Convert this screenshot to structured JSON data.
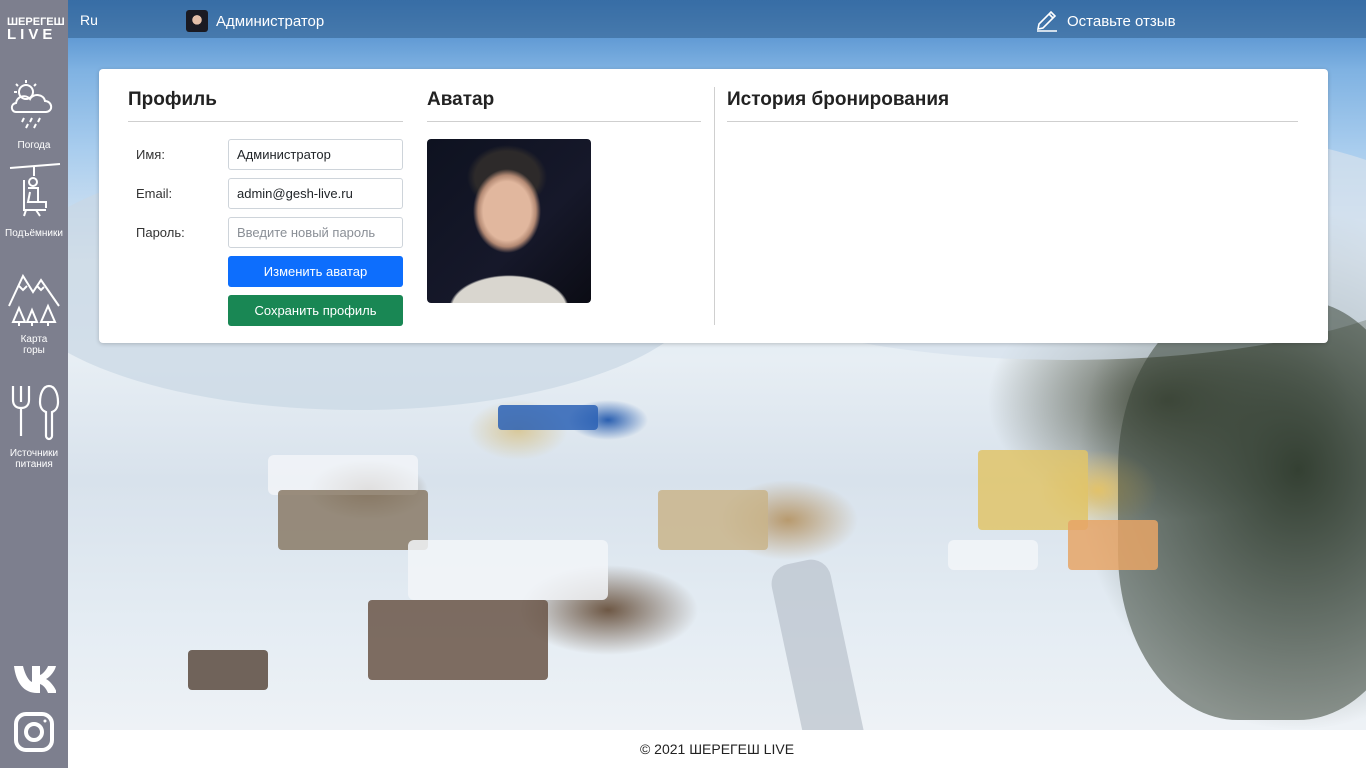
{
  "logo": {
    "line1": "ШЕРЕГЕШ",
    "line2": "LIVE"
  },
  "sidebar": {
    "items": [
      {
        "label": "Погода",
        "icon": "weather-icon"
      },
      {
        "label": "Подъёмники",
        "icon": "ski-lift-icon"
      },
      {
        "label": "Карта горы",
        "icon": "mountain-map-icon"
      },
      {
        "label": "Источники питания",
        "icon": "food-icon"
      }
    ],
    "social": [
      {
        "icon": "vk-icon"
      },
      {
        "icon": "instagram-icon"
      }
    ]
  },
  "topbar": {
    "language": "Ru",
    "username": "Администратор",
    "feedback_label": "Оставьте отзыв"
  },
  "profile": {
    "title": "Профиль",
    "name_label": "Имя:",
    "name_value": "Администратор",
    "email_label": "Email:",
    "email_value": "admin@gesh-live.ru",
    "password_label": "Пароль:",
    "password_placeholder": "Введите новый пароль",
    "change_avatar_label": "Изменить аватар",
    "save_profile_label": "Сохранить профиль"
  },
  "avatar": {
    "title": "Аватар"
  },
  "history": {
    "title": "История бронирования"
  },
  "footer": {
    "text": "© 2021 ШЕРЕГЕШ LIVE"
  },
  "colors": {
    "sidebar": "#7d7f8e",
    "primary": "#0d6efd",
    "success": "#198754"
  }
}
